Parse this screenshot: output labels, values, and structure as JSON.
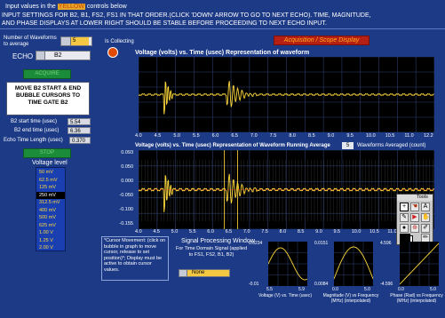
{
  "header": {
    "line1_a": "Input values in the",
    "line1_highlight": "YELLOW",
    "line1_b": "controls below",
    "line2": "INPUT SETTINGS FOR B2, B1, FS2, FS1 IN THAT ORDER.(CLICK 'DOWN' ARROW TO GO TO NEXT ECHO).  TIME, MAGNITUDE,",
    "line3": "AND PHASE DISPLAYS AT LOWER RIGHT SHOULD BE STABLE BEFORE PROCEEDING TO NEXT ECHO INPUT."
  },
  "controls": {
    "num_waveforms_label": "Number of Waveforms to average",
    "num_waveforms_value": "5",
    "echo_label": "ECHO",
    "echo_value": "B2",
    "acquire_button": "ACQUIRE",
    "instruction_box": "MOVE B2 START & END BUBBLE CURSORS TO TIME GATE B2",
    "start_time_label": "B2 start time (usec)",
    "start_time_value": "5.54",
    "end_time_label": "B2 end time (usec)",
    "end_time_value": "6.36",
    "echo_length_label": "Echo Time Length (usec)",
    "echo_length_value": "0.370",
    "stop_button": "STOP",
    "voltage_level_label": "Voltage level",
    "voltage_options": [
      "50 mV",
      "62.5 mV",
      "125 mV",
      "250 mV",
      "312.5 mV",
      "400 mV",
      "500 mV",
      "625 mV",
      "1.00 V",
      "1.25 V",
      "2.00 V"
    ],
    "voltage_selected_index": 3,
    "collecting_label": "Is Collecting",
    "acq_display_label": "Acquisition / Scope Display"
  },
  "plot1": {
    "title": "Voltage (volts) vs. Time (usec) Representation of waveform",
    "x_ticks": [
      "4.0",
      "4.5",
      "5.0",
      "5.5",
      "6.0",
      "6.5",
      "7.0",
      "7.5",
      "8.0",
      "8.5",
      "9.0",
      "9.5",
      "10.0",
      "10.5",
      "11.0",
      "12.2"
    ]
  },
  "plot2": {
    "title": "Voltage (volts) vs. Time (usec) Representation of Waveform Running Average",
    "averaged_label": "Waveforms Averaged (count)",
    "averaged_value": "5",
    "y_ticks": [
      "0.093",
      "0.050",
      "0.000",
      "-0.050",
      "-0.100",
      "-0.155"
    ],
    "x_ticks": [
      "4.0",
      "4.5",
      "5.0",
      "5.5",
      "6.0",
      "6.5",
      "7.0",
      "7.5",
      "8.0",
      "8.5",
      "9.0",
      "9.5",
      "10.0",
      "10.5",
      "11.0",
      "11.5",
      "12.2"
    ]
  },
  "tools": {
    "title": "Tools"
  },
  "cursor_note": "*Cursor Movement: (click on bubble in graph to move cursor, release to set position)*; Display must be active to obtain cursor values.",
  "signal": {
    "title": "Signal Processing Window",
    "subtitle": "For Time Domain Signal (applied to FS1, FS2, B1, B2)",
    "window_value": "None"
  },
  "mini_plots": [
    {
      "y_top": "0.0234",
      "y_bot": "-0.01",
      "x_ticks": [
        "5.5",
        "5.9"
      ],
      "caption": "Voltage (V) vs. Time (usec)"
    },
    {
      "y_top": "0.0151",
      "y_bot": "0.0084",
      "x_ticks": [
        "0.0",
        "5.0"
      ],
      "caption": "Magnitude (V) vs Frequency (MHz) (interpolated)"
    },
    {
      "y_top": "4.596",
      "y_bot": "-4.596",
      "x_ticks": [
        "0.0",
        "5.0"
      ],
      "caption": "Phase (Rad) vs Frequency (MHz) (interpolated)"
    }
  ],
  "colors": {
    "background": "#1c3a85",
    "accent_yellow": "#ffd93b",
    "button_green": "#1a8c3a",
    "plot_bg": "#000000"
  }
}
